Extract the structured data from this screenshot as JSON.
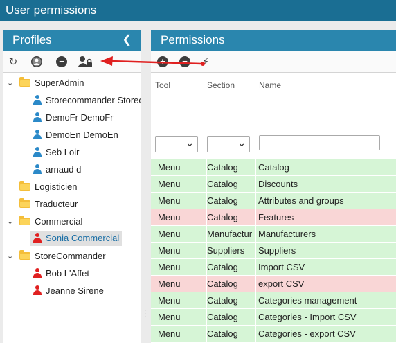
{
  "window": {
    "title": "User permissions"
  },
  "profiles": {
    "header": "Profiles",
    "collapse_icon": "chevron-left-icon",
    "toolbar": [
      "refresh-icon",
      "add-profile-icon",
      "remove-icon",
      "user-lock-icon"
    ],
    "tree": [
      {
        "type": "folder",
        "label": "SuperAdmin",
        "expanded": true
      },
      {
        "type": "user",
        "label": "Storecommander Storecommander",
        "color": "#2b89c8"
      },
      {
        "type": "user",
        "label": "DemoFr DemoFr",
        "color": "#2b89c8"
      },
      {
        "type": "user",
        "label": "DemoEn DemoEn",
        "color": "#2b89c8"
      },
      {
        "type": "user",
        "label": "Seb Loir",
        "color": "#2b89c8"
      },
      {
        "type": "user",
        "label": "arnaud d",
        "color": "#2b89c8"
      },
      {
        "type": "folder",
        "label": "Logisticien",
        "expanded": false
      },
      {
        "type": "folder",
        "label": "Traducteur",
        "expanded": false
      },
      {
        "type": "folder",
        "label": "Commercial",
        "expanded": true
      },
      {
        "type": "user",
        "label": "Sonia Commercial",
        "color": "#e02020",
        "selected": true
      },
      {
        "type": "folder",
        "label": "StoreCommander",
        "expanded": true
      },
      {
        "type": "user",
        "label": "Bob L'Affet",
        "color": "#e02020"
      },
      {
        "type": "user",
        "label": "Jeanne Sirene",
        "color": "#e02020"
      }
    ]
  },
  "permissions": {
    "header": "Permissions",
    "toolbar": [
      "add-icon",
      "remove-icon",
      "bolt-icon"
    ],
    "columns": [
      "Tool",
      "Section",
      "Name"
    ],
    "filters": {
      "tool": "",
      "section": "",
      "name": ""
    },
    "rows": [
      {
        "tool": "Menu",
        "section": "Catalog",
        "name": "Catalog",
        "status": "green"
      },
      {
        "tool": "Menu",
        "section": "Catalog",
        "name": "Discounts",
        "status": "green"
      },
      {
        "tool": "Menu",
        "section": "Catalog",
        "name": "Attributes and groups",
        "status": "green"
      },
      {
        "tool": "Menu",
        "section": "Catalog",
        "name": "Features",
        "status": "pink"
      },
      {
        "tool": "Menu",
        "section": "Manufactur",
        "name": "Manufacturers",
        "status": "green"
      },
      {
        "tool": "Menu",
        "section": "Suppliers",
        "name": "Suppliers",
        "status": "green"
      },
      {
        "tool": "Menu",
        "section": "Catalog",
        "name": "Import CSV",
        "status": "green"
      },
      {
        "tool": "Menu",
        "section": "Catalog",
        "name": "export CSV",
        "status": "pink"
      },
      {
        "tool": "Menu",
        "section": "Catalog",
        "name": "Categories management",
        "status": "green"
      },
      {
        "tool": "Menu",
        "section": "Catalog",
        "name": "Categories - Import CSV",
        "status": "green"
      },
      {
        "tool": "Menu",
        "section": "Catalog",
        "name": "Categories - export CSV",
        "status": "green"
      }
    ]
  },
  "colors": {
    "titlebar": "#1a6e93",
    "panel_header": "#2a86ae",
    "allowed": "#d6f5d6",
    "denied": "#f9d6d6",
    "arrow": "#e02020"
  }
}
